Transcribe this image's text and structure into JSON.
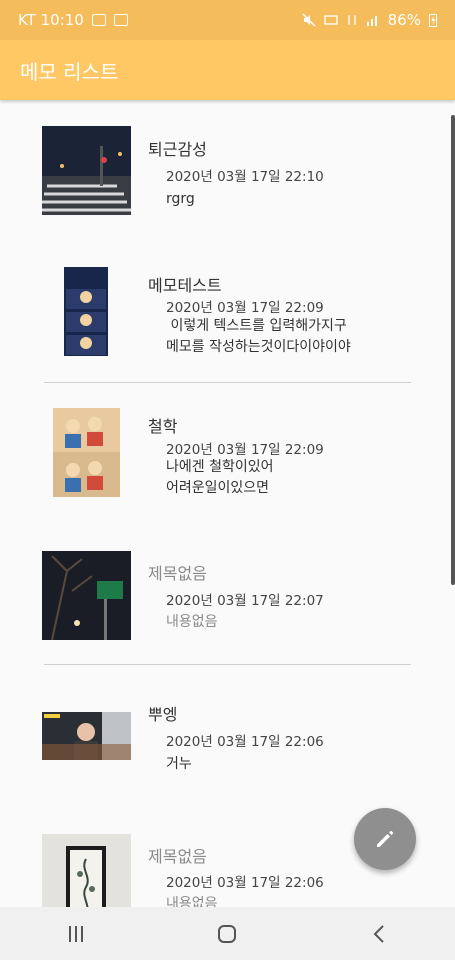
{
  "status_bar": {
    "carrier_time": "KT 10:10",
    "battery": "86%"
  },
  "app_bar": {
    "title": "메모 리스트"
  },
  "memos": [
    {
      "title": "퇴근감성",
      "date": "2020년 03월 17일 22:10",
      "body": "rgrg"
    },
    {
      "title": "메모테스트",
      "date": "2020년 03월 17일 22:09",
      "body": " 이렇게 텍스트를 입력해가지구\n메모를 작성하는것이다이야이야"
    },
    {
      "title": "철학",
      "date": "2020년 03월 17일 22:09",
      "body": "나에겐 철학이있어\n어려운일이있으면"
    },
    {
      "title": "제목없음",
      "date": "2020년 03월 17일 22:07",
      "body": "내용없음"
    },
    {
      "title": "뿌엥",
      "date": "2020년 03월 17일 22:06",
      "body": "거누"
    },
    {
      "title": "제목없음",
      "date": "2020년 03월 17일 22:06",
      "body": "내용없음"
    }
  ],
  "icons": {
    "fab": "pencil-icon",
    "nav_recent": "recent-apps-icon",
    "nav_home": "home-icon",
    "nav_back": "back-icon"
  },
  "colors": {
    "app_bar": "#ffc864",
    "status_bar": "#f5bc5c",
    "fab": "#8f8f8f",
    "background": "#fafafa"
  }
}
